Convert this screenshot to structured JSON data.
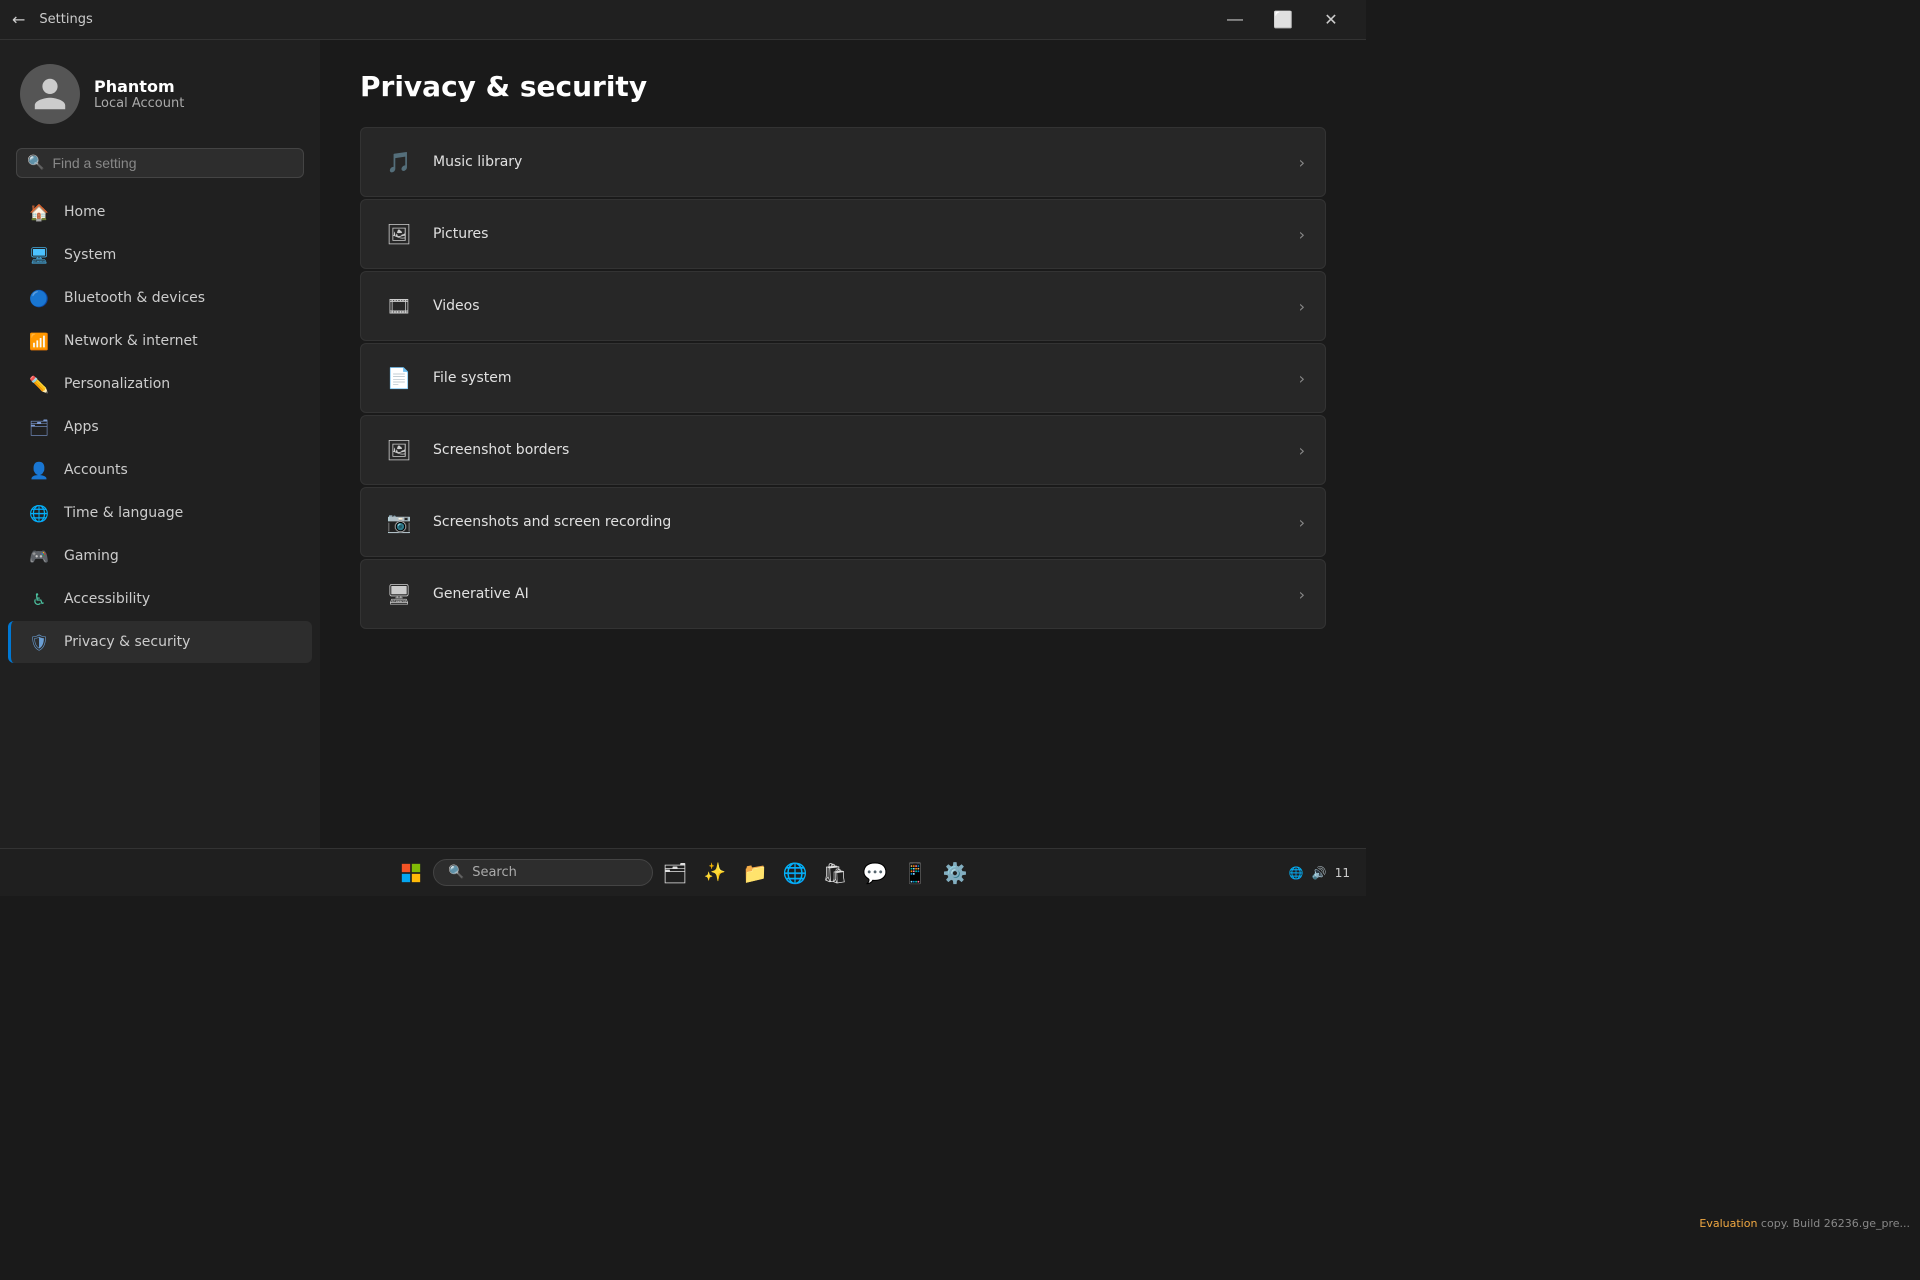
{
  "window": {
    "title": "Settings",
    "controls": {
      "minimize": "—",
      "maximize": "⬜",
      "close": "✕"
    }
  },
  "sidebar": {
    "user": {
      "name": "Phantom",
      "type": "Local Account"
    },
    "search": {
      "placeholder": "Find a setting"
    },
    "nav": [
      {
        "id": "home",
        "label": "Home",
        "icon": "🏠",
        "iconClass": "home"
      },
      {
        "id": "system",
        "label": "System",
        "icon": "🖥",
        "iconClass": "system"
      },
      {
        "id": "bluetooth",
        "label": "Bluetooth & devices",
        "icon": "🔵",
        "iconClass": "bluetooth"
      },
      {
        "id": "network",
        "label": "Network & internet",
        "icon": "📶",
        "iconClass": "network"
      },
      {
        "id": "personalization",
        "label": "Personalization",
        "icon": "✏️",
        "iconClass": "personalization"
      },
      {
        "id": "apps",
        "label": "Apps",
        "icon": "🗂",
        "iconClass": "apps"
      },
      {
        "id": "accounts",
        "label": "Accounts",
        "icon": "👤",
        "iconClass": "accounts"
      },
      {
        "id": "time",
        "label": "Time & language",
        "icon": "🌐",
        "iconClass": "time"
      },
      {
        "id": "gaming",
        "label": "Gaming",
        "icon": "🎮",
        "iconClass": "gaming"
      },
      {
        "id": "accessibility",
        "label": "Accessibility",
        "icon": "♿",
        "iconClass": "accessibility"
      },
      {
        "id": "privacy",
        "label": "Privacy & security",
        "icon": "🛡",
        "iconClass": "privacy",
        "active": true
      }
    ]
  },
  "content": {
    "title": "Privacy & security",
    "items": [
      {
        "id": "music-library",
        "label": "Music library",
        "icon": "🎵"
      },
      {
        "id": "pictures",
        "label": "Pictures",
        "icon": "🖼"
      },
      {
        "id": "videos",
        "label": "Videos",
        "icon": "🎞"
      },
      {
        "id": "file-system",
        "label": "File system",
        "icon": "📄"
      },
      {
        "id": "screenshot-borders",
        "label": "Screenshot borders",
        "icon": "🖼"
      },
      {
        "id": "screenshots-recording",
        "label": "Screenshots and screen recording",
        "icon": "📷"
      },
      {
        "id": "generative-ai",
        "label": "Generative AI",
        "icon": "🖥"
      }
    ]
  },
  "taskbar": {
    "search_label": "Search",
    "time": "11",
    "eval_text": "Evaluation copy. Build 26236.ge_pre..."
  }
}
